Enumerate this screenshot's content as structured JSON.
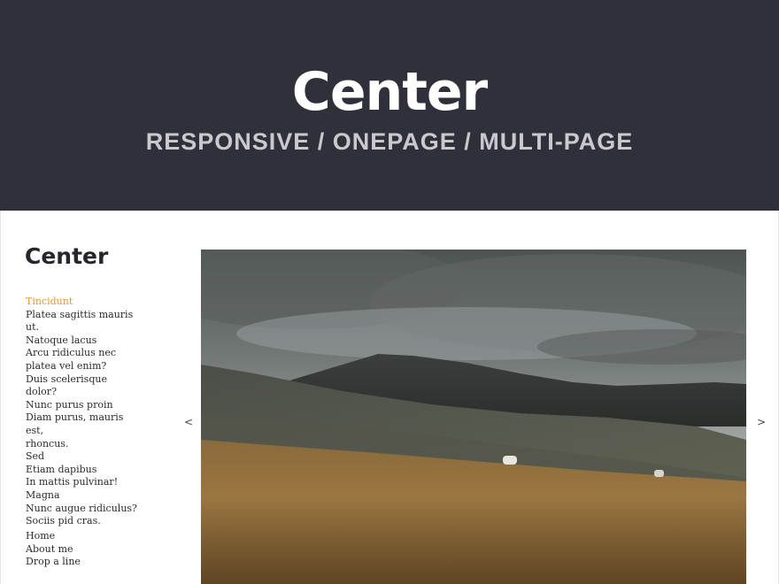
{
  "hero": {
    "title": "Center",
    "subtitle": "RESPONSIVE / ONEPAGE / MULTI-PAGE"
  },
  "sidebar": {
    "brand": "Center",
    "items": [
      "Tincidunt",
      "Platea sagittis mauris",
      "ut.",
      "Natoque lacus",
      "Arcu ridiculus nec",
      "platea vel enim?",
      "Duis scelerisque dolor?",
      "Nunc purus proin",
      "Diam purus, mauris est,",
      "rhoncus.",
      "Sed",
      "Etiam dapibus",
      "In mattis pulvinar!",
      "Magna",
      "Nunc augue ridiculus?",
      "Sociis pid cras."
    ],
    "active_item": "Tincidunt",
    "secondary_items": [
      "Home",
      "About me",
      "Drop a line"
    ]
  },
  "slider": {
    "prev_label": "<",
    "next_label": ">",
    "image": "landscape-photo"
  },
  "colors": {
    "hero_bg": "#30303a",
    "accent": "#e8962e",
    "text": "#2b2b2b"
  }
}
